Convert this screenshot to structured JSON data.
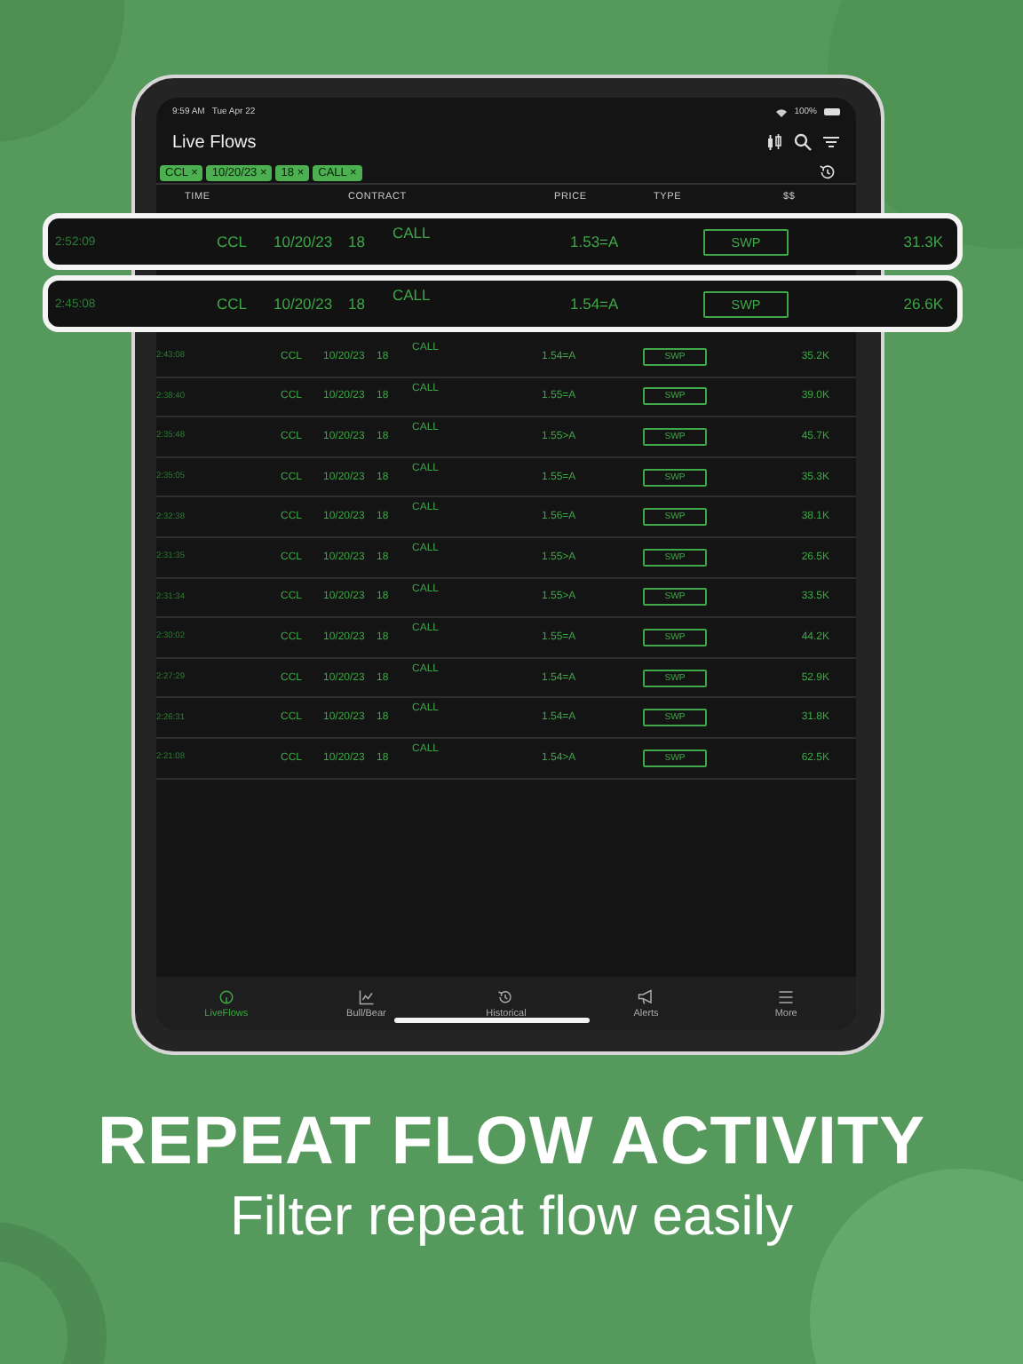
{
  "status_bar": {
    "time": "9:59 AM",
    "date": "Tue Apr 22",
    "battery": "100%"
  },
  "header": {
    "title": "Live Flows"
  },
  "filters": [
    {
      "label": "CCL",
      "remove": "×"
    },
    {
      "label": "10/20/23",
      "remove": "×"
    },
    {
      "label": "18",
      "remove": "×"
    },
    {
      "label": "CALL",
      "remove": "×"
    }
  ],
  "table": {
    "columns": [
      "TIME",
      "CONTRACT",
      "PRICE",
      "TYPE",
      "$$"
    ],
    "rows": [
      {
        "highlighted": true,
        "time": "2:52:09",
        "ticker": "CCL",
        "expiry": "10/20/23",
        "strike": "18",
        "side": "CALL",
        "price": "1.53=A",
        "type": "SWP",
        "value": "31.3K"
      },
      {
        "highlighted": true,
        "time": "2:45:08",
        "ticker": "CCL",
        "expiry": "10/20/23",
        "strike": "18",
        "side": "CALL",
        "price": "1.54=A",
        "type": "SWP",
        "value": "26.6K"
      },
      {
        "highlighted": false,
        "time": "2:43:08",
        "ticker": "CCL",
        "expiry": "10/20/23",
        "strike": "18",
        "side": "CALL",
        "price": "1.54=A",
        "type": "SWP",
        "value": "35.2K"
      },
      {
        "highlighted": false,
        "time": "2:38:40",
        "ticker": "CCL",
        "expiry": "10/20/23",
        "strike": "18",
        "side": "CALL",
        "price": "1.55=A",
        "type": "SWP",
        "value": "39.0K"
      },
      {
        "highlighted": false,
        "time": "2:35:48",
        "ticker": "CCL",
        "expiry": "10/20/23",
        "strike": "18",
        "side": "CALL",
        "price": "1.55>A",
        "type": "SWP",
        "value": "45.7K"
      },
      {
        "highlighted": false,
        "time": "2:35:05",
        "ticker": "CCL",
        "expiry": "10/20/23",
        "strike": "18",
        "side": "CALL",
        "price": "1.55=A",
        "type": "SWP",
        "value": "35.3K"
      },
      {
        "highlighted": false,
        "time": "2:32:38",
        "ticker": "CCL",
        "expiry": "10/20/23",
        "strike": "18",
        "side": "CALL",
        "price": "1.56=A",
        "type": "SWP",
        "value": "38.1K"
      },
      {
        "highlighted": false,
        "time": "2:31:35",
        "ticker": "CCL",
        "expiry": "10/20/23",
        "strike": "18",
        "side": "CALL",
        "price": "1.55>A",
        "type": "SWP",
        "value": "26.5K"
      },
      {
        "highlighted": false,
        "time": "2:31:34",
        "ticker": "CCL",
        "expiry": "10/20/23",
        "strike": "18",
        "side": "CALL",
        "price": "1.55>A",
        "type": "SWP",
        "value": "33.5K"
      },
      {
        "highlighted": false,
        "time": "2:30:02",
        "ticker": "CCL",
        "expiry": "10/20/23",
        "strike": "18",
        "side": "CALL",
        "price": "1.55=A",
        "type": "SWP",
        "value": "44.2K"
      },
      {
        "highlighted": false,
        "time": "2:27:29",
        "ticker": "CCL",
        "expiry": "10/20/23",
        "strike": "18",
        "side": "CALL",
        "price": "1.54=A",
        "type": "SWP",
        "value": "52.9K"
      },
      {
        "highlighted": false,
        "time": "2:26:31",
        "ticker": "CCL",
        "expiry": "10/20/23",
        "strike": "18",
        "side": "CALL",
        "price": "1.54=A",
        "type": "SWP",
        "value": "31.8K"
      },
      {
        "highlighted": false,
        "time": "2:21:08",
        "ticker": "CCL",
        "expiry": "10/20/23",
        "strike": "18",
        "side": "CALL",
        "price": "1.54>A",
        "type": "SWP",
        "value": "62.5K"
      }
    ]
  },
  "tab_bar": [
    {
      "kind": "gauge",
      "label": "LiveFlows",
      "selected": true
    },
    {
      "kind": "chart",
      "label": "Bull/Bear",
      "selected": false
    },
    {
      "kind": "history",
      "label": "Historical",
      "selected": false
    },
    {
      "kind": "megaphone",
      "label": "Alerts",
      "selected": false
    },
    {
      "kind": "menu",
      "label": "More",
      "selected": false
    }
  ],
  "headline": "REPEAT FLOW ACTIVITY",
  "subheadline": "Filter repeat flow easily"
}
